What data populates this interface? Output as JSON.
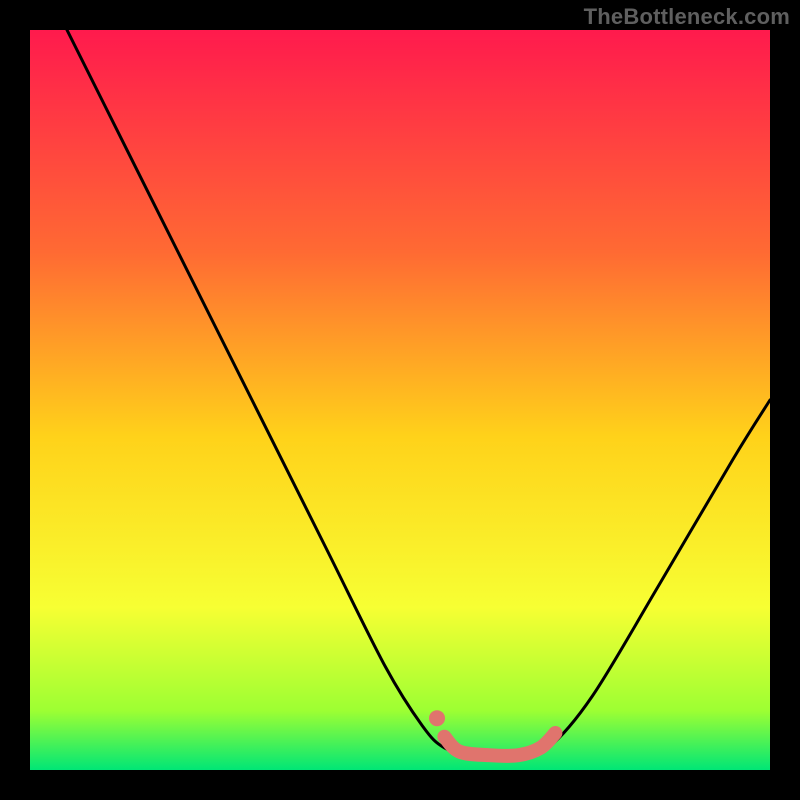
{
  "watermark": "TheBottleneck.com",
  "colors": {
    "background_black": "#000000",
    "gradient_top": "#ff1a4d",
    "gradient_mid_upper": "#ff6a33",
    "gradient_mid": "#ffd21a",
    "gradient_mid_lower": "#f7ff33",
    "gradient_lower": "#9dff33",
    "gradient_bottom": "#00e676",
    "curve": "#000000",
    "marker": "#e0746d"
  },
  "chart_data": {
    "type": "line",
    "title": "",
    "xlabel": "",
    "ylabel": "",
    "xlim": [
      0,
      100
    ],
    "ylim": [
      0,
      100
    ],
    "curve": [
      {
        "x": 5,
        "y": 100
      },
      {
        "x": 10,
        "y": 90
      },
      {
        "x": 20,
        "y": 70
      },
      {
        "x": 30,
        "y": 50
      },
      {
        "x": 40,
        "y": 30
      },
      {
        "x": 48,
        "y": 14
      },
      {
        "x": 53,
        "y": 6
      },
      {
        "x": 56,
        "y": 3
      },
      {
        "x": 60,
        "y": 2
      },
      {
        "x": 66,
        "y": 2
      },
      {
        "x": 70,
        "y": 3
      },
      {
        "x": 76,
        "y": 10
      },
      {
        "x": 85,
        "y": 25
      },
      {
        "x": 95,
        "y": 42
      },
      {
        "x": 100,
        "y": 50
      }
    ],
    "optimal_zone": [
      {
        "x": 56,
        "y": 4.5
      },
      {
        "x": 58,
        "y": 2.5
      },
      {
        "x": 62,
        "y": 2
      },
      {
        "x": 66,
        "y": 2
      },
      {
        "x": 69,
        "y": 3
      },
      {
        "x": 71,
        "y": 5
      }
    ],
    "optimal_point": {
      "x": 55,
      "y": 7
    }
  }
}
